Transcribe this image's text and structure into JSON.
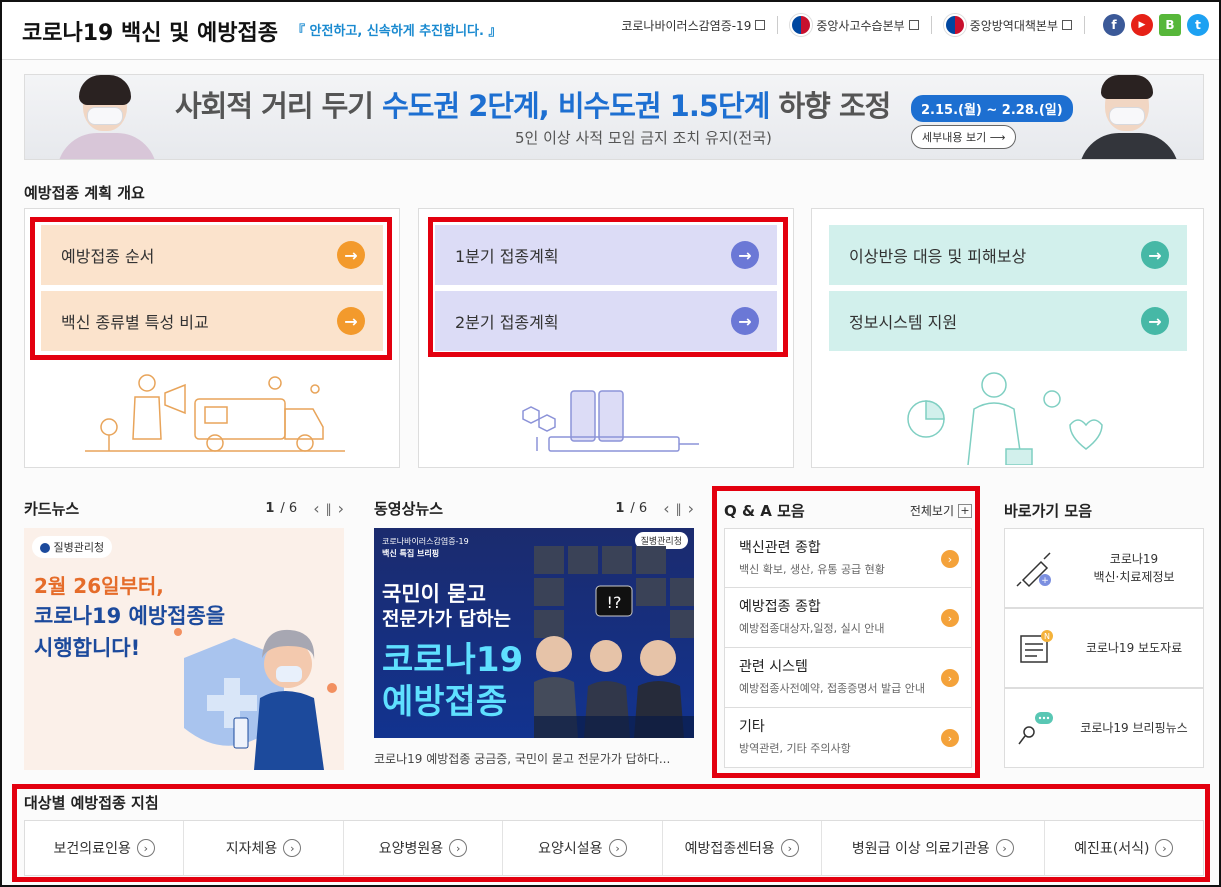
{
  "header": {
    "title": "코로나19 백신 및 예방접종",
    "slogan": "『 안전하고, 신속하게 추진합니다. 』",
    "links": [
      {
        "label": "코로나바이러스감염증-19"
      },
      {
        "label": "중앙사고수습본부"
      },
      {
        "label": "중앙방역대책본부"
      }
    ],
    "sns": [
      {
        "icon": "facebook-icon",
        "glyph": "f",
        "color": "#3b5998"
      },
      {
        "icon": "youtube-icon",
        "glyph": "▶",
        "color": "#e62117"
      },
      {
        "icon": "blog-icon",
        "glyph": "B",
        "color": "#57b73a"
      },
      {
        "icon": "twitter-icon",
        "glyph": "t",
        "color": "#1da1f2"
      }
    ]
  },
  "banner": {
    "main_prefix": "사회적 거리 두기 ",
    "main_highlight": "수도권 2단계, 비수도권 1.5단계",
    "main_suffix": " 하향 조정",
    "date": "2.15.(월) ~ 2.28.(일)",
    "sub": "5인 이상 사적 모임 금지 조치 유지(전국)",
    "more": "세부내용 보기 ⟶"
  },
  "plan": {
    "title": "예방접종 계획 개요",
    "groups": [
      {
        "items": [
          "예방접종 순서",
          "백신 종류별 특성 비교"
        ],
        "bg": "#fbe3cc",
        "arrow": "#f39a2c"
      },
      {
        "items": [
          "1분기 접종계획",
          "2분기 접종계획"
        ],
        "bg": "#dcdcf6",
        "arrow": "#6b78d6"
      },
      {
        "items": [
          "이상반응 대응 및 피해보상",
          "정보시스템 지원"
        ],
        "bg": "#d2f0ec",
        "arrow": "#46b8a6"
      }
    ]
  },
  "cardnews": {
    "title": "카드뉴스",
    "page": "1",
    "total": "/ 6",
    "badge": "질병관리청",
    "line1": "2월 26일부터,",
    "line2": "코로나19 예방접종을",
    "line3": "시행합니다!"
  },
  "video": {
    "title": "동영상뉴스",
    "page": "1",
    "total": "/ 6",
    "badge": "질병관리청",
    "header_small_1": "코로나바이러스감염증-19",
    "header_small_2": "백신 특집 브리핑",
    "headline_1": "국민이 묻고",
    "headline_2": "전문가가 답하는",
    "headline_3": "코로나19",
    "headline_4": "예방접종",
    "caption": "코로나19 예방접종 궁금증, 국민이 묻고 전문가가 답하다..."
  },
  "qa": {
    "title": "Q & A 모음",
    "more": "전체보기",
    "items": [
      {
        "title": "백신관련 종합",
        "desc": "백신 확보, 생산, 유통 공급 현황"
      },
      {
        "title": "예방접종 종합",
        "desc": "예방접종대상자,일정, 실시 안내"
      },
      {
        "title": "관련 시스템",
        "desc": "예방접종사전예약, 접종증명서 발급 안내"
      },
      {
        "title": "기타",
        "desc": "방역관련, 기타 주의사항"
      }
    ]
  },
  "shortcuts": {
    "title": "바로가기 모음",
    "items": [
      {
        "line1": "코로나19",
        "line2": "백신·치료제정보"
      },
      {
        "line1": "코로나19 보도자료",
        "line2": ""
      },
      {
        "line1": "코로나19 브리핑뉴스",
        "line2": ""
      }
    ]
  },
  "targets": {
    "title": "대상별 예방접종 지침",
    "items": [
      "보건의료인용",
      "지자체용",
      "요양병원용",
      "요양시설용",
      "예방접종센터용",
      "병원급 이상 의료기관용",
      "예진표(서식)"
    ]
  }
}
